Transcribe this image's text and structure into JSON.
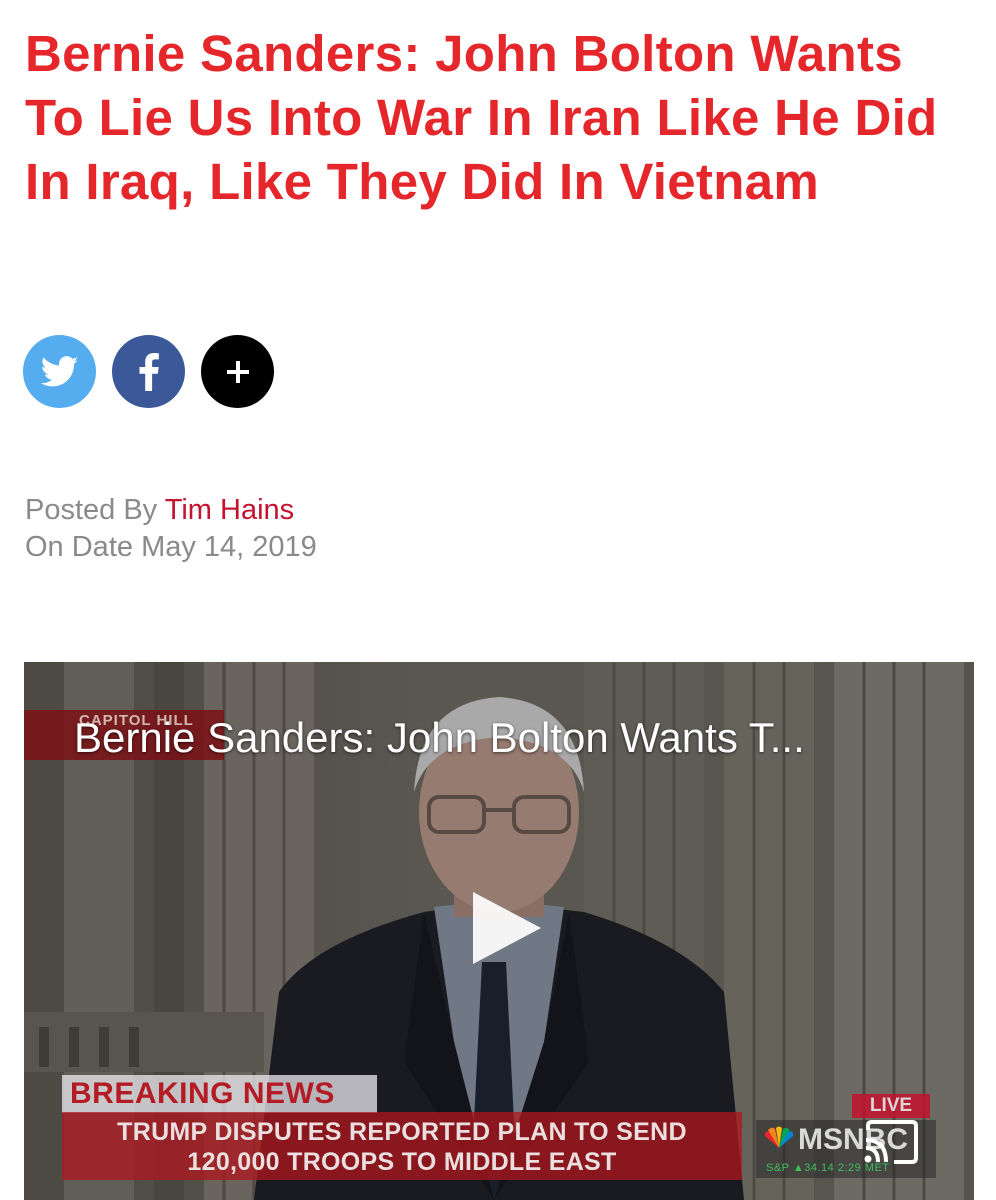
{
  "article": {
    "headline": "Bernie Sanders: John Bolton Wants To Lie Us Into War In Iran Like He Did In Iraq, Like They Did In Vietnam",
    "posted_by_label": "Posted By ",
    "author": "Tim Hains",
    "date_label": "On Date ",
    "date": "May 14, 2019"
  },
  "share": {
    "buttons": [
      {
        "name": "twitter",
        "icon": "twitter-bird-icon",
        "color": "#55acee"
      },
      {
        "name": "facebook",
        "icon": "facebook-f-icon",
        "color": "#3b5998"
      },
      {
        "name": "more",
        "icon": "plus-icon",
        "color": "#000000"
      }
    ]
  },
  "video": {
    "title": "Bernie Sanders: John Bolton Wants T...",
    "location_tag": "CAPITOL HILL",
    "breaking_label": "BREAKING NEWS",
    "chyron_line1": "TRUMP DISPUTES REPORTED PLAN TO SEND",
    "chyron_line2": "120,000 TROOPS TO MIDDLE EAST",
    "live_badge": "LIVE",
    "network": "MSNBC",
    "ticker": "S&P ▲34.14   2:29 MET",
    "play_icon": "play-icon",
    "cast_icon": "cast-icon"
  },
  "colors": {
    "headline": "#e5262b",
    "author_link": "#c4122f",
    "meta_text": "#8a8a8a"
  }
}
